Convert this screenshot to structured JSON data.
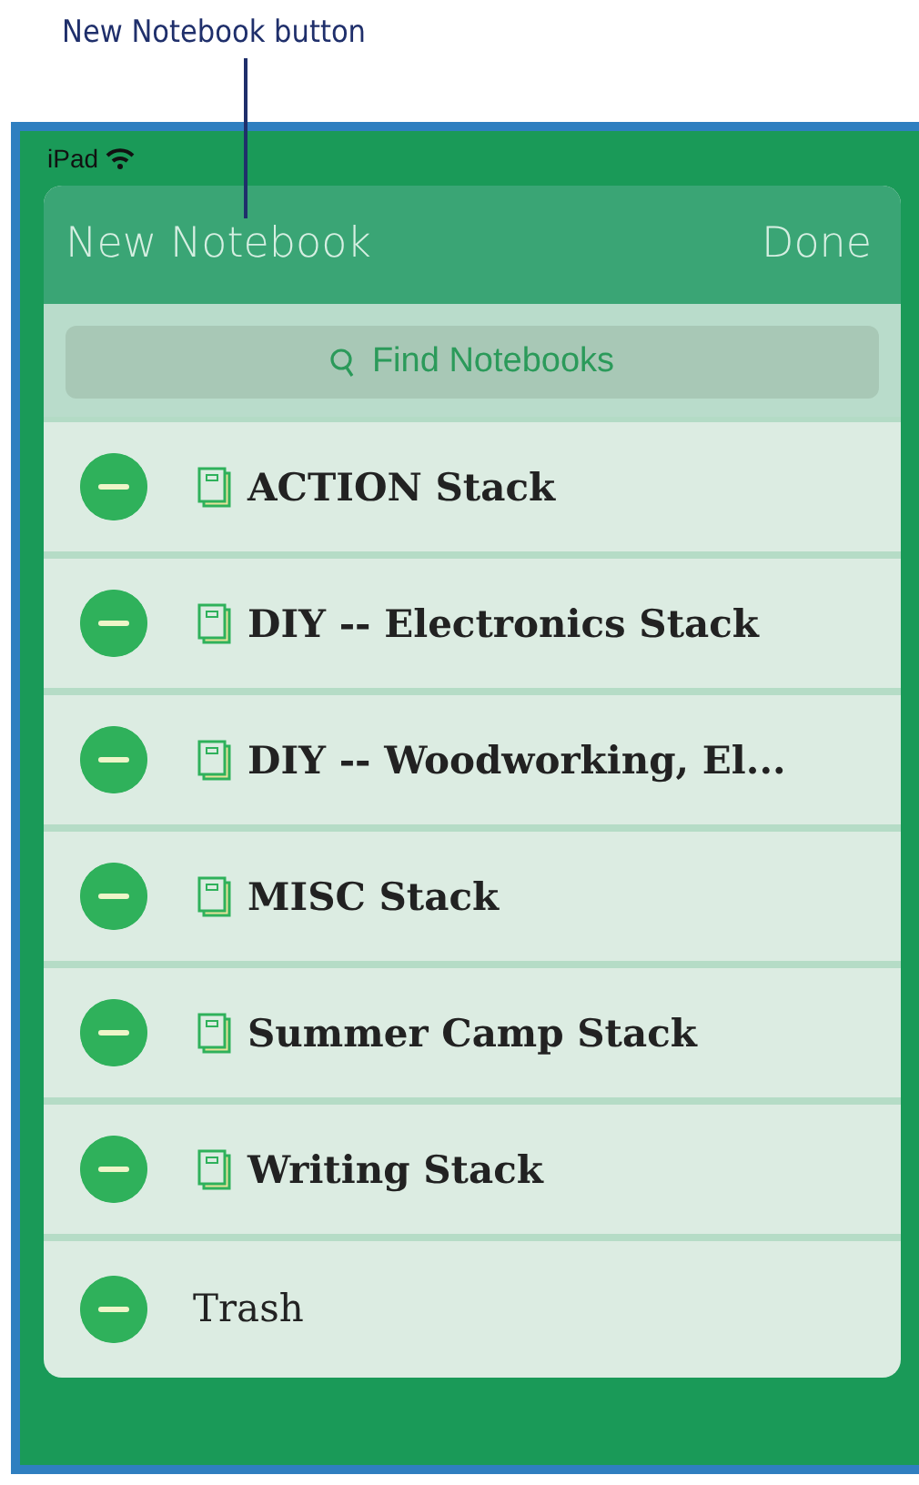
{
  "callout": {
    "label": "New Notebook button"
  },
  "status_bar": {
    "device": "iPad"
  },
  "header": {
    "left_button": "New Notebook",
    "right_button": "Done"
  },
  "search": {
    "placeholder": "Find Notebooks"
  },
  "notebooks": [
    {
      "kind": "stack",
      "name": "ACTION Stack"
    },
    {
      "kind": "stack",
      "name": "DIY -- Electronics Stack"
    },
    {
      "kind": "stack",
      "name": "DIY -- Woodworking, El..."
    },
    {
      "kind": "stack",
      "name": "MISC Stack"
    },
    {
      "kind": "stack",
      "name": "Summer Camp Stack"
    },
    {
      "kind": "stack",
      "name": "Writing Stack"
    },
    {
      "kind": "trash",
      "name": "Trash"
    }
  ]
}
